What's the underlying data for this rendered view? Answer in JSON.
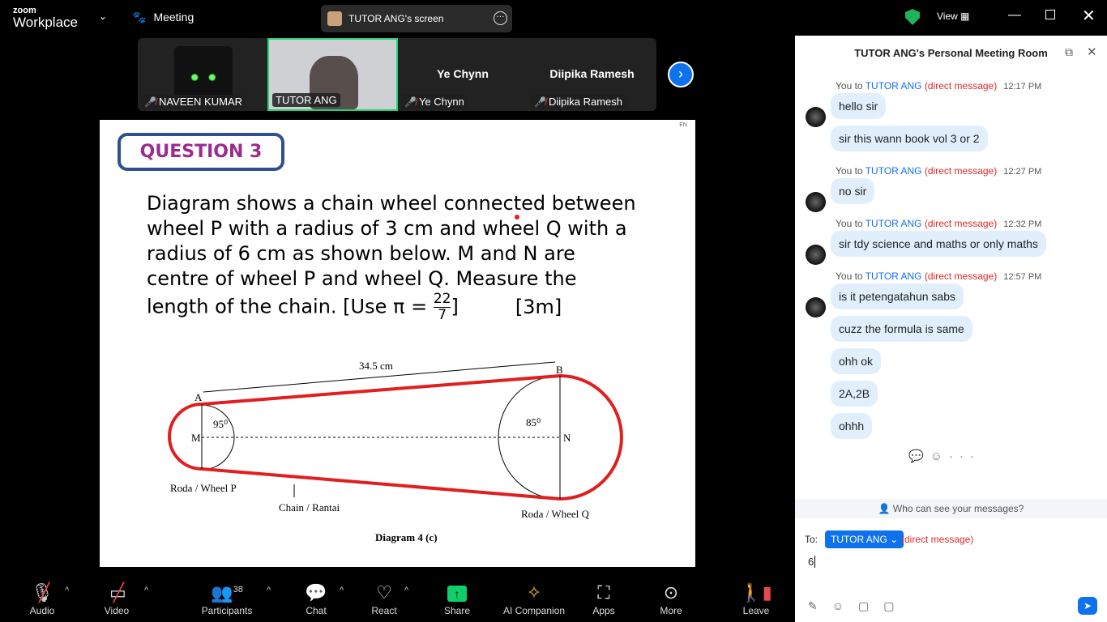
{
  "app": {
    "logo_small": "zoom",
    "logo_big": "Workplace",
    "meeting_label": "Meeting",
    "share_title": "TUTOR ANG's screen",
    "view_label": "View"
  },
  "participants": [
    {
      "name": "NAVEEN KUMAR",
      "muted": true
    },
    {
      "name": "TUTOR ANG",
      "muted": false,
      "active": true
    },
    {
      "name": "Ye Chynn",
      "muted": true
    },
    {
      "name": "Diipika Ramesh",
      "muted": true
    }
  ],
  "slide": {
    "lang": "EN",
    "question_title": "QUESTION 3",
    "body": "Diagram shows a chain wheel connected between wheel P with a radius of 3 cm and wheel Q with a radius of 6 cm as shown below. M and N are centre of wheel P and wheel Q. Measure the length of the chain. [Use π = ",
    "pi_num": "22",
    "pi_den": "7",
    "body_end": "]",
    "marks": "[3m]",
    "diagram": {
      "length_label": "34.5 cm",
      "A": "A",
      "B": "B",
      "M": "M",
      "N": "N",
      "angle_m": "95⁰",
      "angle_n": "85⁰",
      "wheel_p": "Roda / Wheel P",
      "wheel_q": "Roda / Wheel Q",
      "chain": "Chain / Rantai",
      "caption": "Diagram 4 (c)"
    }
  },
  "chat": {
    "title": "TUTOR ANG's Personal Meeting Room",
    "groups": [
      {
        "prefix": "You to ",
        "to": "TUTOR ANG",
        "dm": "(direct message)",
        "time": "12:17 PM",
        "messages": [
          "hello sir",
          "sir this wann book vol 3 or 2"
        ]
      },
      {
        "prefix": "You to ",
        "to": "TUTOR ANG",
        "dm": "(direct message)",
        "time": "12:27 PM",
        "messages": [
          "no sir"
        ]
      },
      {
        "prefix": "You to ",
        "to": "TUTOR ANG",
        "dm": "(direct message)",
        "time": "12:32 PM",
        "messages": [
          "sir tdy science and maths or only maths"
        ]
      },
      {
        "prefix": "You to ",
        "to": "TUTOR ANG",
        "dm": "(direct message)",
        "time": "12:57 PM",
        "messages": [
          "is it petengatahun sabs",
          "cuzz the formula is same",
          "ohh ok",
          "2A,2B",
          "ohhh"
        ]
      }
    ],
    "who_can_see": "Who can see your messages?",
    "to_label": "To:",
    "recipient": "TUTOR ANG",
    "recipient_note": "(direct message)",
    "input_value": "6"
  },
  "toolbar": {
    "audio": "Audio",
    "video": "Video",
    "participants": "Participants",
    "participants_count": "38",
    "chat": "Chat",
    "react": "React",
    "share": "Share",
    "ai": "AI Companion",
    "apps": "Apps",
    "more": "More",
    "leave": "Leave"
  },
  "colors": {
    "accent": "#0e72ed",
    "active_border": "#23d17a",
    "share_green": "#0ecf6a",
    "chain_red": "#e02020",
    "title_purple": "#9b2c8e"
  }
}
